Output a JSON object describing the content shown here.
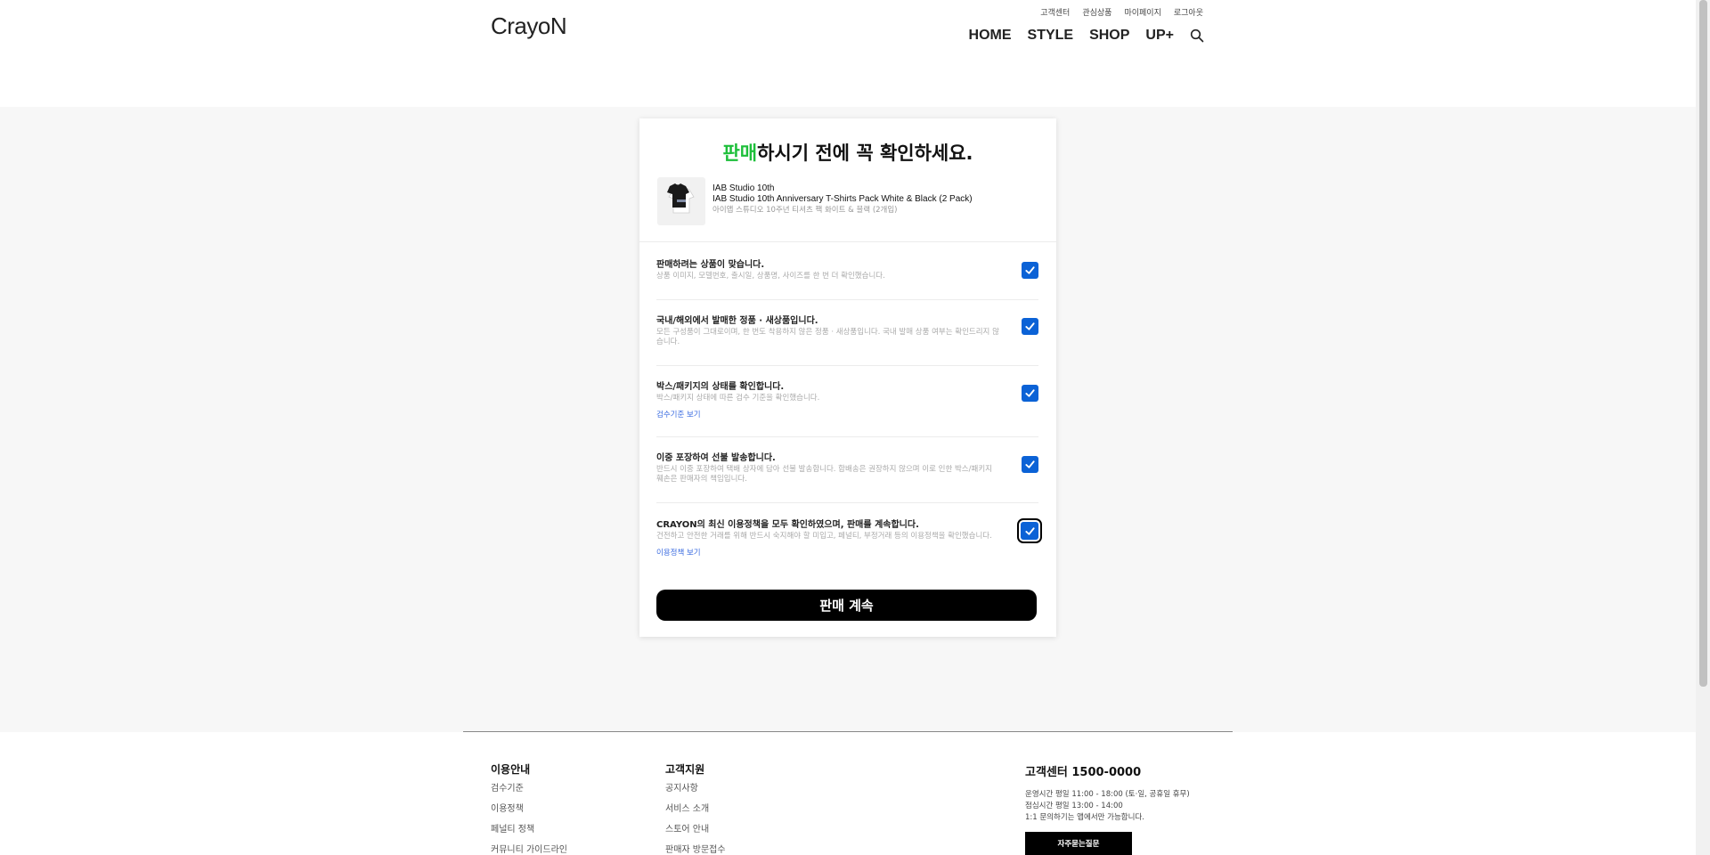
{
  "header": {
    "logo": "CrayoN",
    "top_links": [
      "고객센터",
      "관심상품",
      "마이페이지",
      "로그아웃"
    ],
    "nav": [
      "HOME",
      "STYLE",
      "SHOP",
      "UP+"
    ]
  },
  "card": {
    "title_accent": "판매",
    "title_rest": "하시기 전에 꼭 확인하세요.",
    "product": {
      "brand": "IAB Studio 10th",
      "name": "IAB Studio 10th Anniversary T-Shirts Pack White & Black (2 Pack)",
      "kor_name": "아이앱 스튜디오 10주년 티셔츠 팩 화이트 & 블랙 (2개입)"
    },
    "checks": [
      {
        "title": "판매하려는 상품이 맞습니다.",
        "desc": "상품 이미지, 모델번호, 출시일, 상품명, 사이즈를 한 번 더 확인했습니다.",
        "link": ""
      },
      {
        "title": "국내/해외에서 발매한 정품 · 새상품입니다.",
        "desc": "모든 구성품이 그대로이며, 한 번도 착용하지 않은 정품 · 새상품입니다. 국내 발매 상품 여부는 확인드리지 않습니다.",
        "link": ""
      },
      {
        "title": "박스/패키지의 상태를 확인합니다.",
        "desc": "박스/패키지 상태에 따른 검수 기준을 확인했습니다.",
        "link": "검수기준 보기"
      },
      {
        "title": "이중 포장하여 선불 발송합니다.",
        "desc": "반드시 이중 포장하여 택배 상자에 담아 선불 발송합니다. 합배송은 권장하지 않으며 이로 인한 박스/패키지 훼손은 판매자의 책임입니다.",
        "link": ""
      },
      {
        "title": "CRAYON의 최신 이용정책을 모두 확인하였으며, 판매를 계속합니다.",
        "desc": "건전하고 안전한 거래를 위해 반드시 숙지해야 할 미입고, 페널티, 부정거래 등의 이용정책을 확인했습니다.",
        "link": "이용정책 보기"
      }
    ],
    "continue_label": "판매 계속"
  },
  "footer": {
    "col1": {
      "head": "이용안내",
      "links": [
        "검수기준",
        "이용정책",
        "페널티 정책",
        "커뮤니티 가이드라인"
      ]
    },
    "col2": {
      "head": "고객지원",
      "links": [
        "공지사항",
        "서비스 소개",
        "스토어 안내",
        "판매자 방문접수"
      ]
    },
    "cs": {
      "title": "고객센터 1500-0000",
      "lines": [
        "운영시간 평일 11:00 - 18:00 (토·일, 공휴일 휴무)",
        "점심시간 평일 13:00 - 14:00",
        "1:1 문의하기는 앱에서만 가능합니다."
      ],
      "faq_label": "자주묻는질문"
    }
  },
  "colors": {
    "accent": "#1dbf3a",
    "checkbox": "#0b62d6",
    "link": "#3a6be0",
    "button": "#000000"
  }
}
